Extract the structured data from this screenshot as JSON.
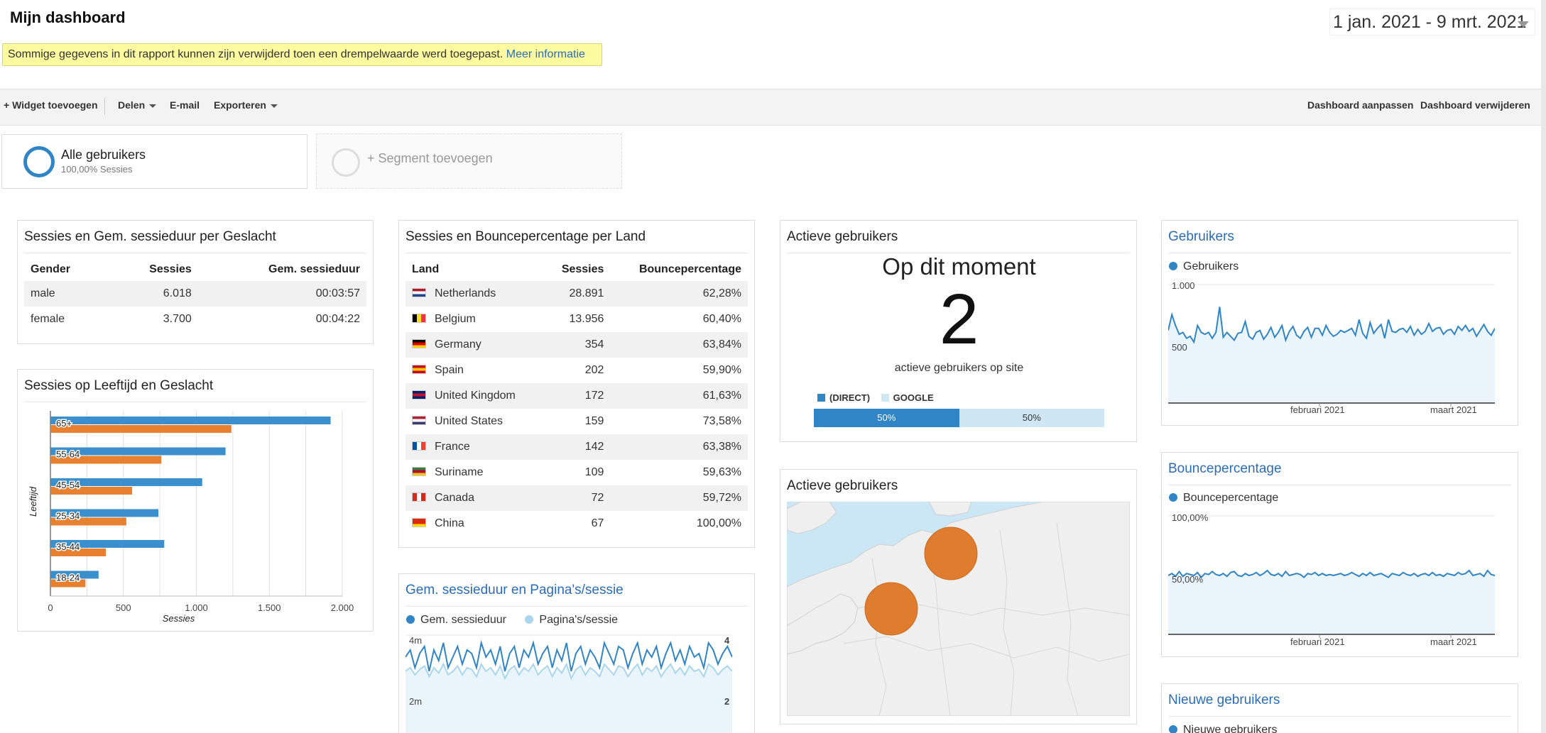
{
  "header": {
    "title": "Mijn dashboard",
    "date_range": "1 jan. 2021 - 9 mrt. 2021"
  },
  "notice": {
    "text": "Sommige gegevens in dit rapport kunnen zijn verwijderd toen een drempelwaarde werd toegepast.",
    "link": "Meer informatie"
  },
  "toolbar": {
    "add_widget": "+ Widget toevoegen",
    "share": "Delen",
    "email": "E-mail",
    "export": "Exporteren",
    "customize": "Dashboard aanpassen",
    "delete": "Dashboard verwijderen"
  },
  "segments": {
    "all_users": "Alle gebruikers",
    "all_users_sub": "100,00% Sessies",
    "add_segment": "+ Segment toevoegen"
  },
  "gender_widget": {
    "title": "Sessies en Gem. sessieduur per Geslacht",
    "columns": [
      "Gender",
      "Sessies",
      "Gem. sessieduur"
    ],
    "rows": [
      [
        "male",
        "6.018",
        "00:03:57"
      ],
      [
        "female",
        "3.700",
        "00:04:22"
      ]
    ]
  },
  "age_widget": {
    "title": "Sessies op Leeftijd en Geslacht"
  },
  "country_widget": {
    "title": "Sessies en Bouncepercentage per Land",
    "columns": [
      "Land",
      "Sessies",
      "Bouncepercentage"
    ],
    "rows": [
      [
        "Netherlands",
        "28.891",
        "62,28%"
      ],
      [
        "Belgium",
        "13.956",
        "60,40%"
      ],
      [
        "Germany",
        "354",
        "63,84%"
      ],
      [
        "Spain",
        "202",
        "59,90%"
      ],
      [
        "United Kingdom",
        "172",
        "61,63%"
      ],
      [
        "United States",
        "159",
        "73,58%"
      ],
      [
        "France",
        "142",
        "63,38%"
      ],
      [
        "Suriname",
        "109",
        "59,63%"
      ],
      [
        "Canada",
        "72",
        "59,72%"
      ],
      [
        "China",
        "67",
        "100,00%"
      ]
    ]
  },
  "duration_widget": {
    "title": "Gem. sessieduur en Pagina's/sessie",
    "legend1": "Gem. sessieduur",
    "legend2": "Pagina's/sessie",
    "y_top_left": "4m",
    "y_mid_left": "2m",
    "y_top_right": "4",
    "y_mid_right": "2"
  },
  "active_widget": {
    "title": "Actieve gebruikers",
    "heading": "Op dit moment",
    "count": "2",
    "caption": "actieve gebruikers op site",
    "legend_direct": "(DIRECT)",
    "legend_google": "GOOGLE",
    "bar_direct": "50%",
    "bar_google": "50%"
  },
  "map_widget": {
    "title": "Actieve gebruikers"
  },
  "users_widget": {
    "title": "Gebruikers",
    "legend": "Gebruikers",
    "y1": "1.000",
    "y2": "500",
    "x1": "februari 2021",
    "x2": "maart 2021"
  },
  "bounce_widget": {
    "title": "Bouncepercentage",
    "legend": "Bouncepercentage",
    "y1": "100,00%",
    "y2": "50,00%",
    "x1": "februari 2021",
    "x2": "maart 2021"
  },
  "newusers_widget": {
    "title": "Nieuwe gebruikers",
    "legend": "Nieuwe gebruikers"
  },
  "colors": {
    "male": "#3a8fcc",
    "female": "#e7812f",
    "accent_blue": "#2f85c6",
    "light_blue": "#a9d6ee"
  },
  "chart_data": [
    {
      "type": "bar",
      "title": "Sessies op Leeftijd en Geslacht",
      "xlabel": "Sessies",
      "ylabel": "Leeftijd",
      "categories": [
        "65+",
        "55-64",
        "45-54",
        "25-34",
        "35-44",
        "18-24"
      ],
      "series": [
        {
          "name": "male",
          "values": [
            1920,
            1200,
            1040,
            740,
            780,
            330
          ]
        },
        {
          "name": "female",
          "values": [
            1240,
            760,
            560,
            520,
            380,
            240
          ]
        }
      ],
      "xlim": [
        0,
        2000
      ],
      "xticks": [
        "0",
        "500",
        "1.000",
        "1.500",
        "2.000"
      ],
      "legend": "bottom",
      "grid": true
    },
    {
      "type": "line",
      "title": "Gebruikers",
      "series": [
        {
          "name": "Gebruikers",
          "values": [
            740,
            900,
            790,
            700,
            720,
            660,
            680,
            620,
            790,
            720,
            700,
            720,
            660,
            720,
            980,
            670,
            720,
            680,
            640,
            710,
            720,
            830,
            680,
            650,
            720,
            740,
            650,
            700,
            770,
            670,
            720,
            790,
            640,
            730,
            780,
            690,
            660,
            730,
            770,
            670,
            760,
            760,
            690,
            790,
            720,
            680,
            700,
            740,
            720,
            740,
            760,
            690,
            850,
            710,
            660,
            820,
            710,
            760,
            800,
            660,
            850,
            730,
            720,
            750,
            760,
            720,
            780,
            690,
            750,
            700,
            730,
            810,
            730,
            760,
            770,
            700,
            740,
            750,
            700,
            780,
            740,
            790,
            730,
            760,
            680,
            740,
            800,
            730,
            690,
            760
          ]
        }
      ],
      "ylim": [
        0,
        1250
      ],
      "yticks": [
        "1.000",
        "500"
      ],
      "xticks": [
        "februari 2021",
        "maart 2021"
      ]
    },
    {
      "type": "line",
      "title": "Bouncepercentage",
      "series": [
        {
          "name": "Bouncepercentage",
          "values": [
            60,
            62,
            59,
            64,
            59,
            62,
            61,
            60,
            63,
            58,
            62,
            61,
            64,
            61,
            60,
            62,
            59,
            63,
            64,
            60,
            59,
            62,
            60,
            61,
            63,
            60,
            62,
            65,
            61,
            60,
            62,
            59,
            64,
            60,
            61,
            62,
            61,
            58,
            62,
            61,
            63,
            60,
            62,
            60,
            61,
            60,
            61,
            62,
            60,
            61,
            63,
            61,
            59,
            62,
            60,
            63,
            60,
            61,
            62,
            60,
            58,
            62,
            61,
            60,
            63,
            61,
            60,
            62,
            59,
            61,
            62,
            60,
            63,
            60,
            61,
            59,
            62,
            61,
            60,
            63,
            61,
            62,
            65,
            60,
            61,
            62,
            59,
            65,
            61,
            60
          ]
        }
      ],
      "ylim": [
        0,
        125
      ],
      "yticks": [
        "100,00%",
        "50,00%"
      ],
      "xticks": [
        "februari 2021",
        "maart 2021"
      ]
    },
    {
      "type": "line",
      "title": "Gem. sessieduur en Pagina's/sessie",
      "series": [
        {
          "name": "Gem. sessieduur",
          "values": [
            230,
            250,
            200,
            240,
            260,
            190,
            250,
            220,
            270,
            200,
            230,
            260,
            210,
            250,
            240,
            200,
            270,
            230,
            250,
            210,
            260,
            190,
            240,
            260,
            200,
            250,
            230,
            270,
            210,
            240,
            260,
            200,
            250,
            220,
            270,
            190,
            240,
            260,
            210,
            250,
            230,
            200,
            270,
            240,
            210,
            260,
            250,
            200,
            240,
            270,
            210,
            250,
            230,
            260,
            200,
            240,
            270,
            220,
            250,
            210,
            260,
            230,
            240,
            200,
            270,
            250,
            210,
            240,
            260,
            230
          ]
        },
        {
          "name": "Pagina's/sessie",
          "values": [
            190,
            200,
            180,
            195,
            205,
            175,
            200,
            185,
            210,
            180,
            190,
            205,
            180,
            200,
            195,
            175,
            210,
            190,
            200,
            180,
            205,
            170,
            195,
            205,
            180,
            200,
            190,
            210,
            180,
            195,
            205,
            175,
            200,
            185,
            210,
            170,
            195,
            205,
            180,
            200,
            190,
            175,
            210,
            195,
            180,
            205,
            200,
            175,
            195,
            210,
            180,
            200,
            190,
            205,
            175,
            195,
            210,
            185,
            200,
            180,
            205,
            190,
            195,
            175,
            210,
            200,
            180,
            195,
            205,
            190
          ]
        }
      ]
    }
  ]
}
